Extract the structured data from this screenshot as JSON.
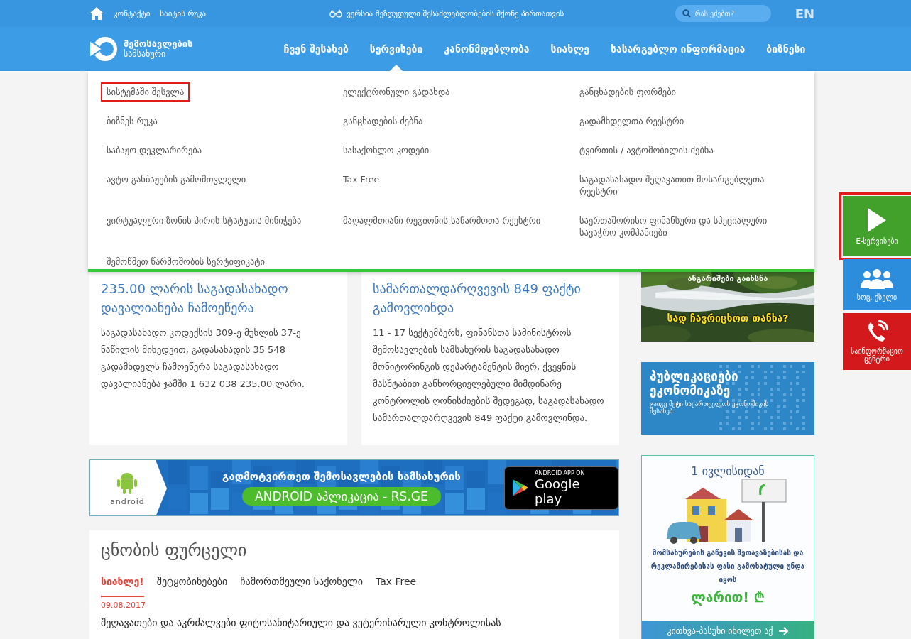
{
  "top_bar": {
    "links": [
      "კონტაქტი",
      "საიტის რუკა"
    ],
    "accessibility_link": "ვერსია შეზღუდული შესაძლებლობების მქონე პირთათვის",
    "search": {
      "placeholder": "რას ეძებთ?"
    },
    "language": "EN"
  },
  "header": {
    "logo": {
      "line_1": "შემოსავლების",
      "line_2": "სამსახური"
    },
    "nav": [
      {
        "label": "ჩვენ შესახებ",
        "selected": false
      },
      {
        "label": "სერვისები",
        "selected": true
      },
      {
        "label": "კანონმდებლობა",
        "selected": false
      },
      {
        "label": "სიახლე",
        "selected": false
      },
      {
        "label": "სასარგებლო ინფორმაცია",
        "selected": false
      },
      {
        "label": "ბიზნესი",
        "selected": false
      }
    ]
  },
  "services_menu": {
    "items": [
      {
        "label": "სისტემაში შესვლა",
        "highlighted": true
      },
      {
        "label": "ელექტრონული გადახდა",
        "highlighted": false
      },
      {
        "label": "განცხადების ფორმები",
        "highlighted": false
      },
      {
        "label": "ბიზნეს რუკა",
        "highlighted": false
      },
      {
        "label": "განცხადების ძებნა",
        "highlighted": false
      },
      {
        "label": "გადამხდელთა რეესტრი",
        "highlighted": false
      },
      {
        "label": "საბაჟო დეკლარირება",
        "highlighted": false
      },
      {
        "label": "სასაქონლო კოდები",
        "highlighted": false
      },
      {
        "label": "ტვირთის / ავტომობილის ძებნა",
        "highlighted": false
      },
      {
        "label": "ავტო განბაჟების გამომთვლელი",
        "highlighted": false
      },
      {
        "label": "Tax Free",
        "highlighted": false
      },
      {
        "label": "საგადასახადო შეღავათით მოსარგებლეთა რეესტრი",
        "highlighted": false
      },
      {
        "label": "ვირტუალური ზონის პირის სტატუსის მინიჭება",
        "highlighted": false
      },
      {
        "label": "მაღალმთიანი რეგიონის საწარმოთა რეესტრი",
        "highlighted": false
      },
      {
        "label": "საერთაშორისო ფინანსური და სპეციალური სავაჭრო კომპანიები",
        "highlighted": false
      },
      {
        "label": "შემოწმეთ წარმოშობის სერტიფიკატი",
        "highlighted": false
      }
    ]
  },
  "news_cards": [
    {
      "title": "235.00 ლარის საგადასახადო დავალიანება ჩამოეწერა",
      "body": "საგადასახადო კოდექსის 309-ე მუხლის 37-ე ნაწილის მიხედვით, გადასახადის 35 548 გადამხდელს ჩამოეწერა საგადასახადო დავალიანება ჯამში 1 632 038 235.00 ლარი."
    },
    {
      "title": "სამართალდარღვევის 849 ფაქტი გამოვლინდა",
      "body": "11 - 17 სექტემბერს, ფინანსთა სამინისტროს შემოსავლების სამსახურის საგადასახადო მონიტორინგის დეპარტამენტის მიერ, ქვეყნის მასშტაბით განხორციელებული მიმდინარე კონტროლის ღონისძიების შედეგად, საგადასახადო სამართალდარღვევის 849 ფაქტი გამოვლინდა."
    }
  ],
  "android_banner": {
    "logo_text": "android",
    "headline": "გადმოტვირთეთ შემოსავლების სამსახურის",
    "app_name": "ANDROID აპლიკაცია - RS.GE",
    "store_badge": {
      "caption": "ANDROID APP ON",
      "name": "Google play"
    }
  },
  "bulletin": {
    "title": "ცნობის ფურცელი",
    "tabs": [
      {
        "label": "სიახლე!",
        "selected": true
      },
      {
        "label": "შეტყობინებები",
        "selected": false
      },
      {
        "label": "ჩამორთმეული საქონელი",
        "selected": false
      },
      {
        "label": "Tax Free",
        "selected": false
      }
    ],
    "date": "09.08.2017",
    "headline": "შეღავათები და აკრძალვები ფიტოსანიტარიული და ვეტერინარული კონტროლისას"
  },
  "promo_photo": {
    "subtitle": "ანგარიშები გაიხსნა",
    "question": "სად ჩავრიცხოთ თანხა?"
  },
  "publications_banner": {
    "title": "პუბლიკაციები ეკონომიკაზე",
    "subtitle": "გაიგე მეტი საქართველოს ეკონომიკის შესახებ"
  },
  "price_notice": {
    "heading": "1 ივლისიდან",
    "text": "მომსახურების გაწევის შეთავაზებისას და რეკლამირებისას ფასი გამოხატული უნდა იყოს",
    "highlight": "ლარით! ₾",
    "footer": "კითხვა-პასუხი იხილეთ აქ"
  },
  "side_buttons": [
    {
      "kind": "e-services",
      "label": "E-სერვისები",
      "highlighted": true
    },
    {
      "kind": "social",
      "label": "სოც. ქსელი",
      "highlighted": false
    },
    {
      "kind": "info",
      "label": "საინფორმაციო ცენტრი",
      "highlighted": false
    }
  ]
}
